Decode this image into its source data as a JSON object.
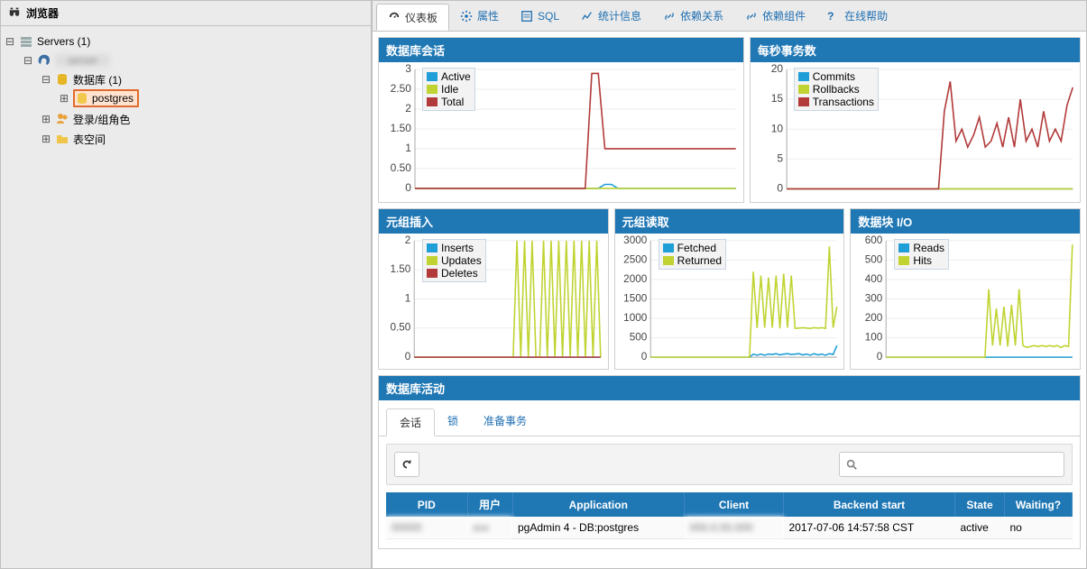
{
  "browser": {
    "title": "浏览器"
  },
  "tree": {
    "server_group": "Servers (1)",
    "server": "server",
    "databases": "数据库 (1)",
    "db": "postgres",
    "roles": "登录/组角色",
    "tablespaces": "表空间"
  },
  "tabs": {
    "dashboard": "仪表板",
    "properties": "属性",
    "sql": "SQL",
    "stats": "统计信息",
    "dependencies": "依赖关系",
    "dependents": "依赖组件",
    "help": "在线帮助"
  },
  "charts": {
    "sessions": {
      "title": "数据库会话",
      "legend": {
        "active": "Active",
        "idle": "Idle",
        "total": "Total"
      }
    },
    "tps": {
      "title": "每秒事务数",
      "legend": {
        "commits": "Commits",
        "rollbacks": "Rollbacks",
        "trans": "Transactions"
      }
    },
    "tins": {
      "title": "元组插入",
      "legend": {
        "inserts": "Inserts",
        "updates": "Updates",
        "deletes": "Deletes"
      }
    },
    "tout": {
      "title": "元组读取",
      "legend": {
        "fetched": "Fetched",
        "returned": "Returned"
      }
    },
    "bio": {
      "title": "数据块 I/O",
      "legend": {
        "reads": "Reads",
        "hits": "Hits"
      }
    }
  },
  "activity": {
    "title": "数据库活动",
    "tabs": {
      "sessions": "会话",
      "locks": "锁",
      "prepared": "准备事务"
    },
    "cols": {
      "pid": "PID",
      "user": "用户",
      "app": "Application",
      "client": "Client",
      "backend": "Backend start",
      "state": "State",
      "waiting": "Waiting?"
    },
    "row": {
      "pid": "00000",
      "user": "xxx",
      "app": "pgAdmin 4 - DB:postgres",
      "client": "000.0.00.000",
      "backend": "2017-07-06 14:57:58 CST",
      "state": "active",
      "waiting": "no"
    },
    "search_placeholder": ""
  },
  "chart_data": [
    {
      "id": "sessions",
      "type": "area",
      "ylim": [
        0,
        3
      ],
      "yticks": [
        0,
        0.5,
        1,
        1.5,
        2,
        2.5,
        3
      ],
      "series": [
        {
          "name": "Active",
          "color": "#1f9ed8",
          "values": [
            0,
            0,
            0,
            0,
            0,
            0,
            0,
            0,
            0,
            0,
            0,
            0,
            0,
            0,
            0,
            0,
            0,
            0,
            0,
            0,
            0,
            0,
            0,
            0,
            0,
            0,
            0,
            0,
            0,
            0.1,
            0.1,
            0,
            0,
            0,
            0,
            0,
            0,
            0,
            0,
            0,
            0,
            0,
            0,
            0,
            0,
            0,
            0,
            0,
            0,
            0
          ]
        },
        {
          "name": "Idle",
          "color": "#c0d330",
          "values": [
            0,
            0,
            0,
            0,
            0,
            0,
            0,
            0,
            0,
            0,
            0,
            0,
            0,
            0,
            0,
            0,
            0,
            0,
            0,
            0,
            0,
            0,
            0,
            0,
            0,
            0,
            0,
            0,
            0,
            0,
            0,
            0,
            0,
            0,
            0,
            0,
            0,
            0,
            0,
            0,
            0,
            0,
            0,
            0,
            0,
            0,
            0,
            0,
            0,
            0
          ]
        },
        {
          "name": "Total",
          "color": "#b23a3a",
          "values": [
            0,
            0,
            0,
            0,
            0,
            0,
            0,
            0,
            0,
            0,
            0,
            0,
            0,
            0,
            0,
            0,
            0,
            0,
            0,
            0,
            0,
            0,
            0,
            0,
            0,
            0,
            0,
            2.9,
            2.9,
            1,
            1,
            1,
            1,
            1,
            1,
            1,
            1,
            1,
            1,
            1,
            1,
            1,
            1,
            1,
            1,
            1,
            1,
            1,
            1,
            1
          ]
        }
      ]
    },
    {
      "id": "tps",
      "type": "line",
      "ylim": [
        0,
        20
      ],
      "yticks": [
        0,
        5,
        10,
        15,
        20
      ],
      "series": [
        {
          "name": "Commits",
          "color": "#1f9ed8",
          "values": [
            0,
            0,
            0,
            0,
            0,
            0,
            0,
            0,
            0,
            0,
            0,
            0,
            0,
            0,
            0,
            0,
            0,
            0,
            0,
            0,
            0,
            0,
            0,
            0,
            0,
            0,
            0,
            0,
            0,
            0,
            0,
            0,
            0,
            0,
            0,
            0,
            0,
            0,
            0,
            0,
            0,
            0,
            0,
            0,
            0,
            0,
            0,
            0,
            0,
            0
          ]
        },
        {
          "name": "Rollbacks",
          "color": "#c0d330",
          "values": [
            0,
            0,
            0,
            0,
            0,
            0,
            0,
            0,
            0,
            0,
            0,
            0,
            0,
            0,
            0,
            0,
            0,
            0,
            0,
            0,
            0,
            0,
            0,
            0,
            0,
            0,
            0,
            0,
            0,
            0,
            0,
            0,
            0,
            0,
            0,
            0,
            0,
            0,
            0,
            0,
            0,
            0,
            0,
            0,
            0,
            0,
            0,
            0,
            0,
            0
          ]
        },
        {
          "name": "Transactions",
          "color": "#b23a3a",
          "values": [
            0,
            0,
            0,
            0,
            0,
            0,
            0,
            0,
            0,
            0,
            0,
            0,
            0,
            0,
            0,
            0,
            0,
            0,
            0,
            0,
            0,
            0,
            0,
            0,
            0,
            0,
            0,
            13,
            18,
            8,
            10,
            7,
            9,
            12,
            7,
            8,
            11,
            7,
            12,
            7,
            15,
            8,
            10,
            7,
            13,
            8,
            10,
            8,
            14,
            17
          ]
        }
      ]
    },
    {
      "id": "tins",
      "type": "line",
      "ylim": [
        0,
        2
      ],
      "yticks": [
        0,
        0.5,
        1,
        1.5,
        2
      ],
      "series": [
        {
          "name": "Inserts",
          "color": "#1f9ed8",
          "values": [
            0,
            0,
            0,
            0,
            0,
            0,
            0,
            0,
            0,
            0,
            0,
            0,
            0,
            0,
            0,
            0,
            0,
            0,
            0,
            0,
            0,
            0,
            0,
            0,
            0,
            0,
            0,
            0,
            0,
            0,
            0,
            0,
            0,
            0,
            0,
            0,
            0,
            0,
            0,
            0,
            0,
            0,
            0,
            0,
            0,
            0,
            0,
            0,
            0,
            0
          ]
        },
        {
          "name": "Updates",
          "color": "#c0d330",
          "values": [
            0,
            0,
            0,
            0,
            0,
            0,
            0,
            0,
            0,
            0,
            0,
            0,
            0,
            0,
            0,
            0,
            0,
            0,
            0,
            0,
            0,
            0,
            0,
            0,
            0,
            0,
            0,
            2,
            0,
            2,
            0,
            2,
            0,
            0,
            2,
            0,
            2,
            0,
            2,
            0,
            2,
            0,
            2,
            0,
            2,
            0,
            2,
            0,
            2,
            0
          ]
        },
        {
          "name": "Deletes",
          "color": "#b23a3a",
          "values": [
            0,
            0,
            0,
            0,
            0,
            0,
            0,
            0,
            0,
            0,
            0,
            0,
            0,
            0,
            0,
            0,
            0,
            0,
            0,
            0,
            0,
            0,
            0,
            0,
            0,
            0,
            0,
            0,
            0,
            0,
            0,
            0,
            0,
            0,
            0,
            0,
            0,
            0,
            0,
            0,
            0,
            0,
            0,
            0,
            0,
            0,
            0,
            0,
            0,
            0
          ]
        }
      ]
    },
    {
      "id": "tout",
      "type": "line",
      "ylim": [
        0,
        3000
      ],
      "yticks": [
        0,
        500,
        1000,
        1500,
        2000,
        2500,
        3000
      ],
      "series": [
        {
          "name": "Fetched",
          "color": "#1f9ed8",
          "values": [
            0,
            0,
            0,
            0,
            0,
            0,
            0,
            0,
            0,
            0,
            0,
            0,
            0,
            0,
            0,
            0,
            0,
            0,
            0,
            0,
            0,
            0,
            0,
            0,
            0,
            0,
            0,
            80,
            50,
            80,
            50,
            80,
            70,
            90,
            60,
            80,
            90,
            70,
            80,
            90,
            60,
            80,
            50,
            90,
            60,
            80,
            50,
            90,
            70,
            300
          ]
        },
        {
          "name": "Returned",
          "color": "#c0d330",
          "values": [
            0,
            0,
            0,
            0,
            0,
            0,
            0,
            0,
            0,
            0,
            0,
            0,
            0,
            0,
            0,
            0,
            0,
            0,
            0,
            0,
            0,
            0,
            0,
            0,
            0,
            0,
            0,
            2200,
            750,
            2100,
            760,
            2050,
            760,
            2100,
            740,
            2150,
            760,
            2100,
            740,
            750,
            760,
            750,
            740,
            760,
            750,
            760,
            740,
            2850,
            760,
            1300
          ]
        }
      ]
    },
    {
      "id": "bio",
      "type": "line",
      "ylim": [
        0,
        600
      ],
      "yticks": [
        0,
        100,
        200,
        300,
        400,
        500,
        600
      ],
      "series": [
        {
          "name": "Reads",
          "color": "#1f9ed8",
          "values": [
            0,
            0,
            0,
            0,
            0,
            0,
            0,
            0,
            0,
            0,
            0,
            0,
            0,
            0,
            0,
            0,
            0,
            0,
            0,
            0,
            0,
            0,
            0,
            0,
            0,
            0,
            0,
            0,
            0,
            0,
            0,
            0,
            0,
            0,
            0,
            0,
            0,
            0,
            0,
            0,
            0,
            0,
            0,
            0,
            0,
            0,
            0,
            0,
            0,
            0
          ]
        },
        {
          "name": "Hits",
          "color": "#c0d330",
          "values": [
            0,
            0,
            0,
            0,
            0,
            0,
            0,
            0,
            0,
            0,
            0,
            0,
            0,
            0,
            0,
            0,
            0,
            0,
            0,
            0,
            0,
            0,
            0,
            0,
            0,
            0,
            0,
            350,
            60,
            250,
            60,
            260,
            55,
            270,
            60,
            350,
            60,
            50,
            55,
            60,
            55,
            60,
            55,
            60,
            55,
            60,
            50,
            60,
            55,
            580
          ]
        }
      ]
    }
  ]
}
